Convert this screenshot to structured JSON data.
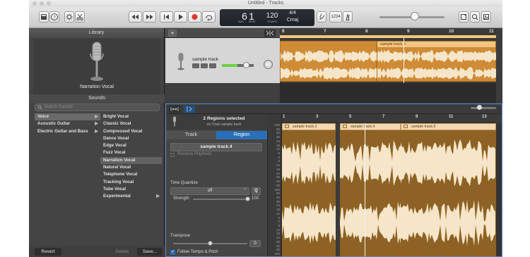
{
  "window": {
    "title": "Untitled - Tracks"
  },
  "lcd": {
    "bar": "6",
    "beat": "1",
    "bar_label": "BAR",
    "beat_label": "BEAT",
    "tempo": "120",
    "tempo_label": "TEMPO",
    "time_signature": "4/4",
    "key": "Cmaj"
  },
  "toolbar": {
    "count_in": "1234"
  },
  "library": {
    "title": "Library",
    "patch_name": "Narration Vocal",
    "sounds_title": "Sounds",
    "search_placeholder": "Search Sounds",
    "categories": [
      {
        "label": "Voice",
        "arrow": "▶"
      },
      {
        "label": "Acoustic Guitar",
        "arrow": "▶"
      },
      {
        "label": "Electric Guitar and Bass",
        "arrow": "▶"
      }
    ],
    "sounds": [
      "Bright Vocal",
      "Classic Vocal",
      "Compressed Vocal",
      "Dance Vocal",
      "Edge Vocal",
      "Fuzz Vocal",
      "Narration Vocal",
      "Natural Vocal",
      "Telephone Vocal",
      "Tracking Vocal",
      "Tube Vocal",
      "Experimental"
    ],
    "experimental_arrow": "▶",
    "revert": "Revert",
    "delete": "Delete",
    "save": "Save..."
  },
  "tracks": {
    "add": "+",
    "track_name": "sample track",
    "ruler": [
      "6",
      "7",
      "8",
      "9",
      "10",
      "11"
    ],
    "region_label": "sample track.5"
  },
  "editor": {
    "status_title": "2 Regions selected",
    "status_sub": "on Track sample track",
    "tab_track": "Track",
    "tab_region": "Region",
    "region_name": "sample track.4",
    "reverse_playback": "Reverse Playback",
    "time_quantize": "Time Quantize",
    "quantize_value": "off",
    "q_button": "Q",
    "strength": "Strength",
    "strength_value": "100",
    "strength_level": 1.0,
    "transpose": "Transpose",
    "transpose_value": "0",
    "transpose_level": 0.5,
    "follow_tempo": "Follow Tempo & Pitch",
    "follow_checked": "✓",
    "ruler": [
      "1",
      "3",
      "5",
      "7",
      "9",
      "11",
      "13"
    ],
    "regions": [
      "sample track.2",
      "sample track.4",
      "sample track.5"
    ],
    "scale": [
      "100",
      "60",
      "40",
      "30",
      "24",
      "18",
      "12",
      "6",
      "0",
      "6",
      "12",
      "18",
      "24",
      "30",
      "40",
      "60",
      "100",
      "60",
      "40",
      "30",
      "24",
      "18",
      "12",
      "6",
      "0",
      "6",
      "12",
      "18",
      "24",
      "30",
      "40",
      "60",
      "100"
    ]
  },
  "colors": {
    "region_orange": "#cf8b35",
    "region_header": "#f0c682",
    "editor_border": "#5b8dc9",
    "waveform": "#f6e5c8",
    "volume_green": "#6bd145",
    "record_red": "#e0362c"
  }
}
